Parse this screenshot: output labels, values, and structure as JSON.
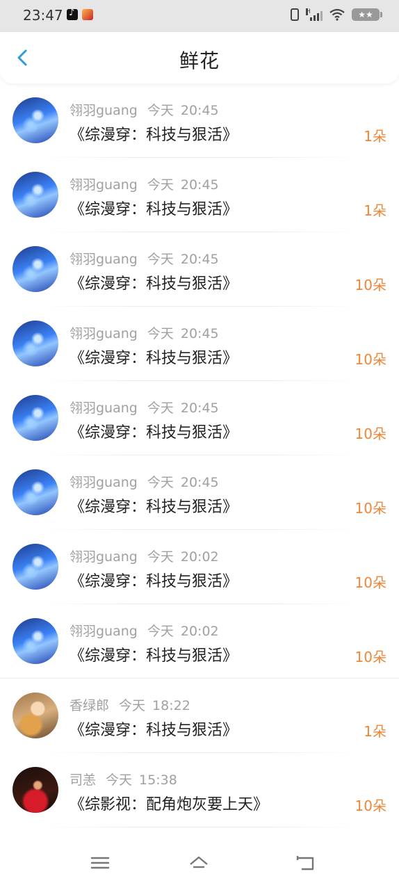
{
  "status_bar": {
    "time": "23:47",
    "battery_text": "★★"
  },
  "header": {
    "title": "鲜花",
    "back_icon": "chevron-left-icon",
    "accent_color": "#2b9be0"
  },
  "records": [
    {
      "user": "翎羽guang",
      "day": "今天",
      "time": "20:45",
      "book": "《综漫穿：科技与狠活》",
      "count": "1朵",
      "avatar": "blue"
    },
    {
      "user": "翎羽guang",
      "day": "今天",
      "time": "20:45",
      "book": "《综漫穿：科技与狠活》",
      "count": "1朵",
      "avatar": "blue"
    },
    {
      "user": "翎羽guang",
      "day": "今天",
      "time": "20:45",
      "book": "《综漫穿：科技与狠活》",
      "count": "10朵",
      "avatar": "blue"
    },
    {
      "user": "翎羽guang",
      "day": "今天",
      "time": "20:45",
      "book": "《综漫穿：科技与狠活》",
      "count": "10朵",
      "avatar": "blue"
    },
    {
      "user": "翎羽guang",
      "day": "今天",
      "time": "20:45",
      "book": "《综漫穿：科技与狠活》",
      "count": "10朵",
      "avatar": "blue"
    },
    {
      "user": "翎羽guang",
      "day": "今天",
      "time": "20:45",
      "book": "《综漫穿：科技与狠活》",
      "count": "10朵",
      "avatar": "blue"
    },
    {
      "user": "翎羽guang",
      "day": "今天",
      "time": "20:02",
      "book": "《综漫穿：科技与狠活》",
      "count": "10朵",
      "avatar": "blue"
    },
    {
      "user": "翎羽guang",
      "day": "今天",
      "time": "20:02",
      "book": "《综漫穿：科技与狠活》",
      "count": "10朵",
      "avatar": "blue"
    },
    {
      "user": "香绿郎",
      "day": "今天",
      "time": "18:22",
      "book": "《综漫穿：科技与狠活》",
      "count": "1朵",
      "avatar": "gold"
    },
    {
      "user": "司恙",
      "day": "今天",
      "time": "15:38",
      "book": "《综影视：配角炮灰要上天》",
      "count": "10朵",
      "avatar": "red"
    }
  ],
  "colors": {
    "count_color": "#f08536",
    "meta_color": "#a0a0a0",
    "title_color": "#222222"
  },
  "bottom_nav": {
    "icons": [
      "menu-icon",
      "home-icon",
      "back-icon"
    ]
  }
}
